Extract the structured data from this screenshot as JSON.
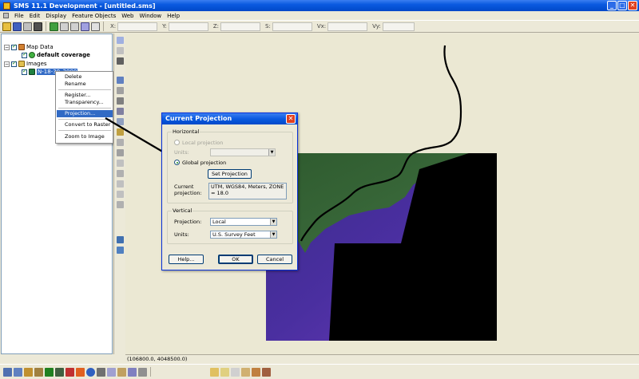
{
  "app": {
    "title": "SMS 11.1 Development - [untitled.sms]"
  },
  "menu": [
    "File",
    "Edit",
    "Display",
    "Feature Objects",
    "Web",
    "Window",
    "Help"
  ],
  "coords": {
    "labels": [
      "X:",
      "Y:",
      "Z:",
      "S:",
      "Vx:",
      "Vy:"
    ]
  },
  "tree": {
    "map_data": "Map Data",
    "default_coverage": "default coverage",
    "images": "Images",
    "image_item": "N-18-30_2000"
  },
  "context_menu": {
    "items": [
      "Delete",
      "Rename",
      "Register...",
      "Transparency...",
      "Projection...",
      "Convert to Raster",
      "Zoom to Image"
    ],
    "highlighted": "Projection..."
  },
  "dialog": {
    "title": "Current Projection",
    "horizontal": {
      "legend": "Horizontal",
      "local_projection": "Local projection",
      "units_label": "Units:",
      "global_projection": "Global projection",
      "set_projection": "Set Projection",
      "current_projection_label": "Current projection:",
      "current_projection_value": "UTM, WGS84, Meters, ZONE = 18.0"
    },
    "vertical": {
      "legend": "Vertical",
      "projection_label": "Projection:",
      "projection_value": "Local",
      "units_label": "Units:",
      "units_value": "U.S. Survey Feet"
    },
    "buttons": {
      "help": "Help...",
      "ok": "OK",
      "cancel": "Cancel"
    }
  },
  "status": {
    "coordinate": "(106800.0, 4048500.0)"
  },
  "colors": {
    "selection": "#316ac5",
    "title_bar": "#0a5ae0",
    "satellite_ocean": "#3a2a8a"
  }
}
